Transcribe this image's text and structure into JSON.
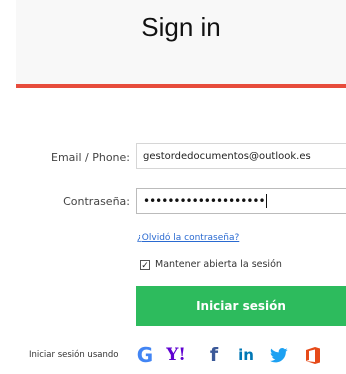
{
  "header": {
    "title": "Sign in"
  },
  "form": {
    "email_label": "Email / Phone:",
    "email_value": "gestordedocumentos@outlook.es",
    "password_label": "Contraseña:",
    "password_value": "••••••••••••••••••••",
    "forgot_link": "¿Olvidó la contraseña?",
    "keep_signed_label": "Mantener abierta la sesión",
    "keep_signed_checked": true,
    "checkbox_mark": "✓",
    "submit_label": "Iniciar sesión"
  },
  "social": {
    "label": "Iniciar sesión usando",
    "google": "G",
    "yahoo": "Y!",
    "facebook": "f",
    "linkedin": "in",
    "providers": [
      "google-icon",
      "yahoo-icon",
      "facebook-icon",
      "linkedin-icon",
      "twitter-icon",
      "office-icon"
    ]
  },
  "colors": {
    "accent_bar": "#e74c3c",
    "submit_bg": "#2dbb5d",
    "link": "#2a6ad1"
  }
}
